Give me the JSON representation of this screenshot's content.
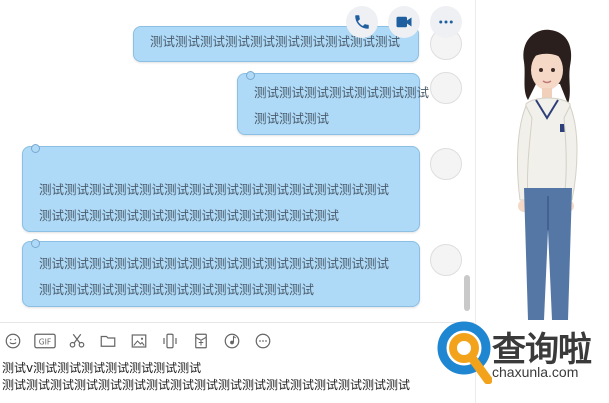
{
  "header": {
    "actions": [
      {
        "icon": "phone-icon"
      },
      {
        "icon": "video-icon"
      },
      {
        "icon": "more-icon"
      }
    ]
  },
  "messages": [
    {
      "lines": [
        "测试测试测试测试测试测试测试测试测试测试"
      ]
    },
    {
      "lines": [
        "测试测试测试测试测试测试测试",
        "测试测试测试"
      ]
    },
    {
      "lines": [
        "测试测试测试测试测试测试测试测试测试测试测试测试测试测试",
        "测试测试测试测试测试测试测试测试测试测试测试测试"
      ]
    },
    {
      "lines": [
        "测试测试测试测试测试测试测试测试测试测试测试测试测试测试",
        "测试测试测试测试测试测试测试测试测试测试测试"
      ]
    }
  ],
  "toolbar": {
    "gif_label": "GIF",
    "tools": [
      "emoji-icon",
      "gif-icon",
      "scissors-icon",
      "folder-icon",
      "image-icon",
      "shake-icon",
      "red-packet-icon",
      "music-icon",
      "more-icon"
    ]
  },
  "input": {
    "lines": [
      "测试v测试测试测试测试测试测试测试",
      "测试测试测试测试测试测试测试测试测试测试测试测试测试测试测试测试测试"
    ]
  },
  "watermark": {
    "brand": "查询啦",
    "domain": "chaxunla.com",
    "accent": "#2f8fd0"
  }
}
